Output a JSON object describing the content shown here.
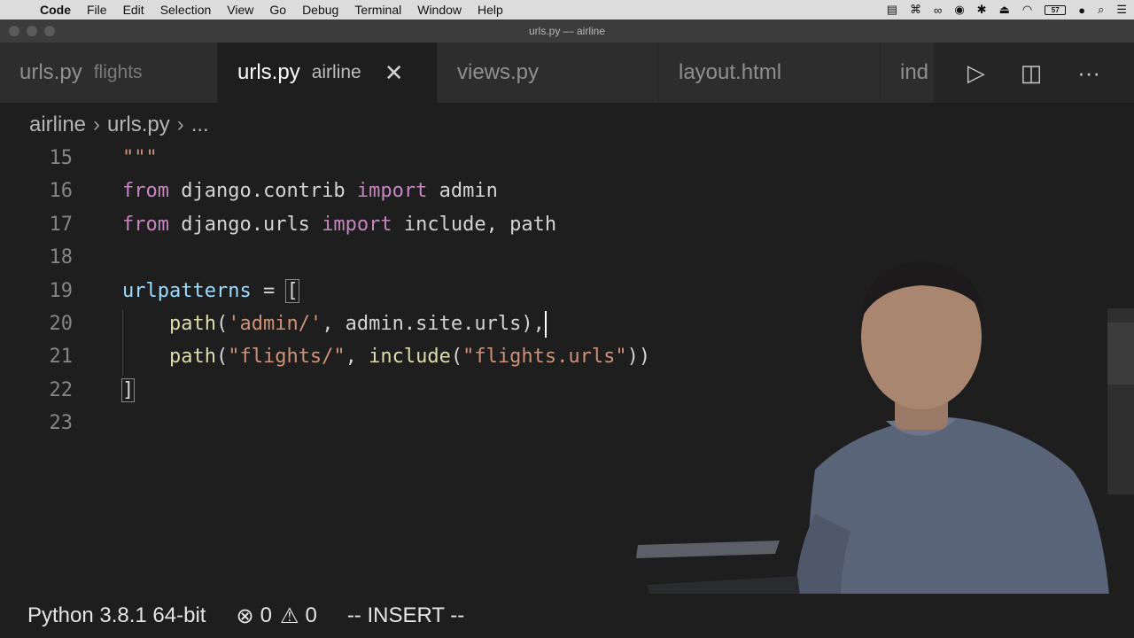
{
  "menubar": {
    "app": "Code",
    "items": [
      "File",
      "Edit",
      "Selection",
      "View",
      "Go",
      "Debug",
      "Terminal",
      "Window",
      "Help"
    ],
    "battery": "57"
  },
  "window": {
    "title": "urls.py — airline"
  },
  "tabs": [
    {
      "name": "urls.py",
      "desc": "flights"
    },
    {
      "name": "urls.py",
      "desc": "airline",
      "close": "✕"
    },
    {
      "name": "views.py"
    },
    {
      "name": "layout.html"
    },
    {
      "name": "ind"
    }
  ],
  "breadcrumb": {
    "folder": "airline",
    "file": "urls.py",
    "more": "..."
  },
  "editor": {
    "line_numbers": [
      "15",
      "16",
      "17",
      "18",
      "19",
      "20",
      "21",
      "22",
      "23"
    ],
    "l15": "\"\"\"",
    "l16": {
      "kw1": "from",
      "mod": "django.contrib",
      "kw2": "import",
      "name": "admin"
    },
    "l17": {
      "kw1": "from",
      "mod": "django.urls",
      "kw2": "import",
      "name": "include, path"
    },
    "l19": {
      "var": "urlpatterns",
      "op": " = ",
      "bracket": "["
    },
    "l20": {
      "fn": "path",
      "open": "(",
      "str": "'admin/'",
      "rest": ", admin.site.urls),",
      "indent": "    "
    },
    "l21": {
      "fn": "path",
      "open": "(",
      "str": "\"flights/\"",
      "mid": ", ",
      "fn2": "include",
      "open2": "(",
      "str2": "\"flights.urls\"",
      "close": "))",
      "indent": "    "
    },
    "l22": "]"
  },
  "statusbar": {
    "python": "Python 3.8.1 64-bit",
    "errors": "0",
    "warnings": "0",
    "mode": "-- INSERT --"
  },
  "colors": {
    "keyword": "#c586c0",
    "string": "#ce9178",
    "function": "#dcdcaa",
    "variable": "#9cdcfe"
  }
}
